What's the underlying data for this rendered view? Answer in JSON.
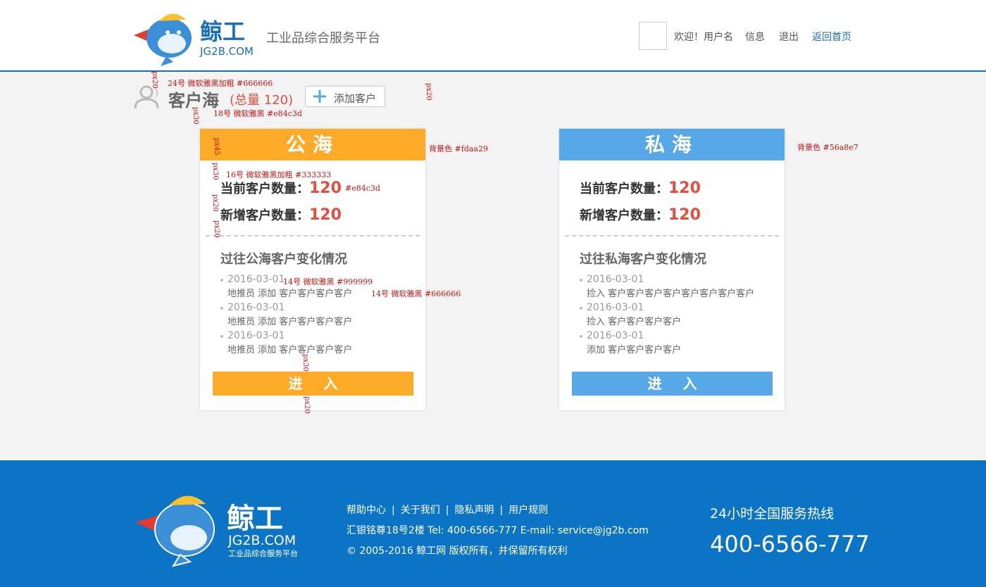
{
  "header": {
    "tagline": "工业品综合服务平台",
    "welcome": "欢迎！用户名",
    "nav": {
      "info": "信息",
      "logout": "退出",
      "home": "返回首页"
    },
    "logo_text": "鲸工",
    "logo_sub": "JG2B.COM"
  },
  "title": {
    "label": "客户海",
    "total": "(总量 120)",
    "add_button": "添加客户"
  },
  "cards": [
    {
      "name": "公海",
      "color": "#fdaa29",
      "current_label": "当前客户数量：",
      "current_value": "120",
      "new_label": "新增客户数量：",
      "new_value": "120",
      "history_title": "过往公海客户变化情况",
      "records": [
        {
          "date": "2016-03-01",
          "desc": "地推员  添加  客户客户客户客户"
        },
        {
          "date": "2016-03-01",
          "desc": "地推员  添加  客户客户客户客户"
        },
        {
          "date": "2016-03-01",
          "desc": "地推员  添加  客户客户客户客户"
        }
      ],
      "enter_button": "进入"
    },
    {
      "name": "私海",
      "color": "#56a8e7",
      "current_label": "当前客户数量：",
      "current_value": "120",
      "new_label": "新增客户数量：",
      "new_value": "120",
      "history_title": "过往私海客户变化情况",
      "records": [
        {
          "date": "2016-03-01",
          "desc": "捡入  客户客户客户客户客户客户客户客户"
        },
        {
          "date": "2016-03-01",
          "desc": "捡入  客户客户客户客户"
        },
        {
          "date": "2016-03-01",
          "desc": "添加  客户客户客户客户"
        }
      ],
      "enter_button": "进入"
    }
  ],
  "annotations": {
    "title_font": "24号 微软雅黑加粗 #666666",
    "total_font": "18号 微软雅黑 #e84c3d",
    "public_bg": "背景色 #fdaa29",
    "private_bg": "背景色 #56a8e7",
    "stat_font": "16号 微软雅黑加粗 #333333",
    "value_color": "#e84c3d",
    "date_font": "14号 微软雅黑 #999999",
    "desc_font": "14号 微软雅黑 #666666",
    "px20": "px20",
    "px30": "px30",
    "px45": "px45"
  },
  "footer": {
    "links": [
      "帮助中心",
      "关于我们",
      "隐私声明",
      "用户规则"
    ],
    "separator": "|",
    "address": "汇银铭尊18号2楼    Tel: 400-6566-777    E-mail: service@jg2b.com",
    "copyright": "© 2005-2016 鲸工网 版权所有，并保留所有权利",
    "hotline_label": "24小时全国服务热线",
    "hotline": "400-6566-777",
    "logo_text": "鲸工",
    "logo_sub": "JG2B.COM",
    "logo_tagline": "工业品综合服务平台"
  },
  "colors": {
    "brand": "#1a6fbc",
    "footer": "#0b74c4",
    "orange": "#fdaa29",
    "blue": "#56a8e7",
    "red": "#e84c3d"
  }
}
